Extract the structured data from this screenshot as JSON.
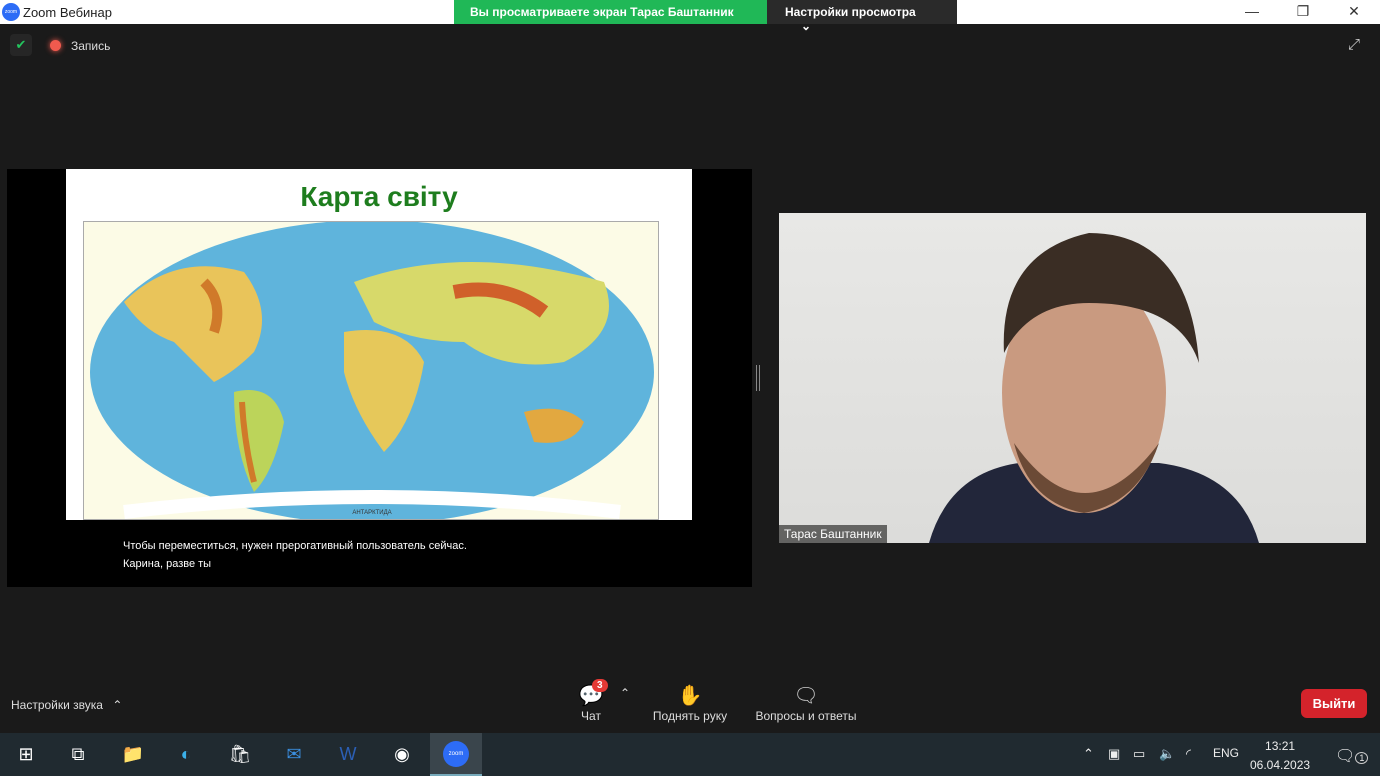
{
  "window": {
    "title": "Zoom Вебинар",
    "logo_text": "zoom"
  },
  "banner": {
    "viewing": "Вы просматриваете экран Тарас Баштанник",
    "view_options": "Настройки просмотра"
  },
  "topbar": {
    "recording_label": "Запись"
  },
  "slide": {
    "title": "Карта світу",
    "map_label": "АНТАРКТИДА"
  },
  "captions": [
    "Чтобы переместиться, нужен прерогативный пользователь сейчас.",
    "Карина, разве ты"
  ],
  "video": {
    "participant_name": "Тарас Баштанник"
  },
  "controls": {
    "audio_settings": "Настройки звука",
    "chat": "Чат",
    "chat_badge": "3",
    "raise_hand": "Поднять руку",
    "qa": "Вопросы и ответы",
    "leave": "Выйти"
  },
  "taskbar": {
    "lang": "ENG",
    "time": "13:21",
    "date": "06.04.2023",
    "notifications": "1"
  }
}
